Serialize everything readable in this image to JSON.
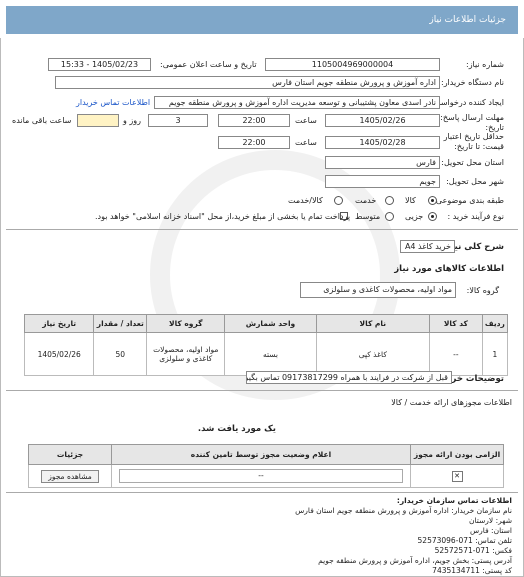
{
  "header": {
    "title": "جزئیات اطلاعات نیاز"
  },
  "fields": {
    "need_number_label": "شماره نیاز:",
    "need_number": "1105004969000004",
    "announce_label": "تاریخ و ساعت اعلان عمومی:",
    "announce_value": "1405/02/23 - 15:33",
    "buyer_label": "نام دستگاه خریدار:",
    "buyer_value": "اداره آموزش و پرورش منطقه جویم استان فارس",
    "creator_label": "ایجاد کننده درخواست:",
    "creator_value": "نادر اسدی معاون پشتیبانی و توسعه مدیریت اداره آموزش و پرورش منطقه جویم",
    "contact_link": "اطلاعات تماس خریدار",
    "deadline_label": "مهلت ارسال پاسخ: تا تاریخ:",
    "deadline_date": "1405/02/26",
    "time_label": "ساعت",
    "deadline_time": "22:00",
    "days_value": "3",
    "days_label": "روز و",
    "remaining_label": "ساعت باقی مانده",
    "validity_label": "حداقل تاریخ اعتبار قیمت: تا تاریخ:",
    "validity_date": "1405/02/28",
    "validity_time": "22:00",
    "province_label": "استان محل تحویل:",
    "province_value": "فارس",
    "city_label": "شهر محل تحویل:",
    "city_value": "جویم",
    "category_label": "طبقه بندی موضوعی:",
    "cat_goods": "کالا",
    "cat_service": "خدمت",
    "cat_goods_service": "کالا/خدمت",
    "process_label": "نوع فرآیند خرید :",
    "proc_partial": "جزیی",
    "proc_medium": "متوسط",
    "payment_note": "پرداخت تمام یا بخشی از مبلغ خرید،از محل \"اسناد خزانه اسلامی\" خواهد بود."
  },
  "summary": {
    "label": "شرح کلی نیاز:",
    "value": "خرید کاغذ A4"
  },
  "goods": {
    "section_title": "اطلاعات کالاهای مورد نیاز",
    "group_label": "گروه کالا:",
    "group_value": "مواد اولیه، محصولات کاغذی و سلولزی",
    "headers": [
      "ردیف",
      "کد کالا",
      "نام کالا",
      "واحد شمارش",
      "گروه کالا",
      "تعداد / مقدار",
      "تاریخ نیاز"
    ],
    "rows": [
      {
        "row": "1",
        "code": "--",
        "name": "کاغذ کپی",
        "unit": "بسته",
        "group": "مواد اولیه، محصولات کاغذی و سلولزی",
        "qty": "50",
        "date": "1405/02/26"
      }
    ]
  },
  "buyer_notes": {
    "label": "توضیحات خریدار:",
    "value": "قبل از شرکت در فرایند با همراه 09173817299 تماس بگیرید."
  },
  "permits": {
    "section_title": "اطلاعات مجوزهای ارائه خدمت / کالا",
    "not_found": "یک مورد یافت شد.",
    "headers": [
      "الزامی بودن ارائه مجوز",
      "اعلام وضعیت مجوز توسط تامین کننده",
      "جزئیات"
    ],
    "row": {
      "status": "--",
      "button": "مشاهده مجوز"
    }
  },
  "contact": {
    "title": "اطلاعات تماس سازمان خریدار:",
    "org": "نام سازمان خریدار: اداره آموزش و پرورش منطقه جویم استان فارس",
    "city": "شهر: لارستان",
    "province": "استان: فارس",
    "phone": "تلفن تماس: 071-52573096",
    "fax": "فکس: 071-52572571",
    "address": "آدرس پستی: بخش جویم، اداره آموزش و پرورش منطقه جویم",
    "postal": "کد پستی: 7435134711"
  }
}
